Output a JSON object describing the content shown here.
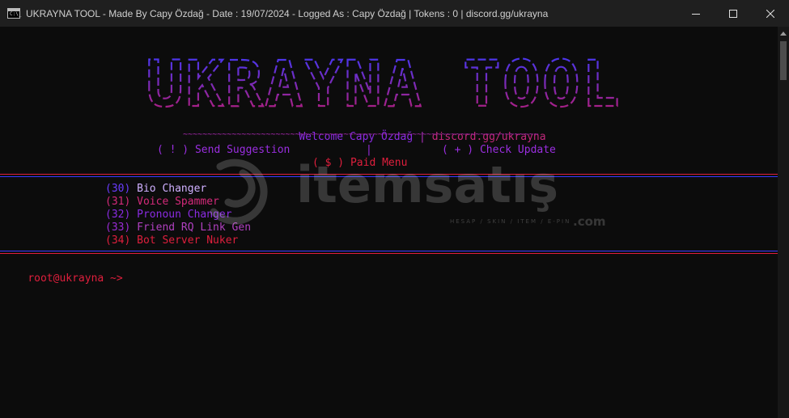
{
  "window": {
    "icon_text": "C:\\_",
    "title": "UKRAYNA TOOL - Made By Capy Özdağ - Date : 19/07/2024 - Logged As : Capy Özdağ | Tokens : 0 | discord.gg/ukrayna",
    "minimize_icon": "minimize-icon",
    "maximize_icon": "maximize-icon",
    "close_icon": "close-icon"
  },
  "banner": {
    "text": "UKRAYNA TOOL",
    "colors": [
      "#3a3aff",
      "#c01a6a"
    ]
  },
  "header": {
    "welcome": "Welcome Capy Özdağ",
    "divider": "|",
    "discord": "discord.gg/ukrayna",
    "tilde_rule": "~~~~~~~~~~~~~~~~~~~~~~~~~~~~~~~~~~~~~~~~~~~~~~~~~~~~~~~~~~~~~~~~~~~~~~~~~~~~~~~~~~~~~~~~~",
    "send_suggestion": "( ! ) Send Suggestion",
    "mid_divider": "|",
    "check_update": "( + ) Check Update",
    "paid_menu": "( $ ) Paid Menu"
  },
  "menu": [
    {
      "num": "(30)",
      "label": "Bio Changer"
    },
    {
      "num": "(31)",
      "label": "Voice Spammer"
    },
    {
      "num": "(32)",
      "label": "Pronoun Changer"
    },
    {
      "num": "(33)",
      "label": "Friend RQ Link Gen"
    },
    {
      "num": "(34)",
      "label": "Bot Server Nuker"
    }
  ],
  "prompt": {
    "text": "root@ukrayna ~>"
  },
  "watermark": {
    "name": "itemsatış",
    "tagline": "HESAP / SKIN / ITEM / E-PIN",
    "suffix": ".com"
  },
  "colors": {
    "blue": "#4a3cff",
    "violet": "#8a2be2",
    "pink": "#d42a7a",
    "red": "#e01f3d",
    "purple_mix": "#9b2bd6"
  }
}
